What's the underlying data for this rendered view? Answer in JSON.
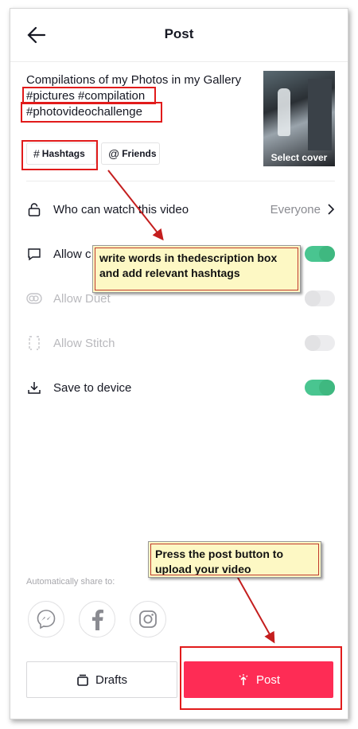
{
  "header": {
    "title": "Post"
  },
  "description": {
    "line1": "Compilations of my Photos in my Gallery",
    "line2": "#pictures #compilation",
    "line3": "#photovideochallenge"
  },
  "cover": {
    "label": "Select cover"
  },
  "chips": {
    "hashtags": "Hashtags",
    "friends": "Friends"
  },
  "settings": {
    "who_can_watch": {
      "label": "Who can watch this video",
      "value": "Everyone"
    },
    "allow_comments": {
      "label": "Allow c",
      "enabled": true
    },
    "allow_duet": {
      "label": "Allow Duet",
      "enabled": false
    },
    "allow_stitch": {
      "label": "Allow Stitch",
      "enabled": false
    },
    "save_to_device": {
      "label": "Save to device",
      "enabled": true
    }
  },
  "share": {
    "label": "Automatically share to:",
    "targets": [
      "messenger-icon",
      "facebook-icon",
      "instagram-icon"
    ]
  },
  "actions": {
    "drafts": "Drafts",
    "post": "Post"
  },
  "annotations": {
    "callout1": "write words in thedescription box and add relevant hashtags",
    "callout2": "Press the post button to upload your video"
  },
  "colors": {
    "accent": "#fe2c55",
    "toggle_on": "#49c590",
    "highlight": "#e11b1b",
    "callout_bg": "#fdf8c4"
  }
}
